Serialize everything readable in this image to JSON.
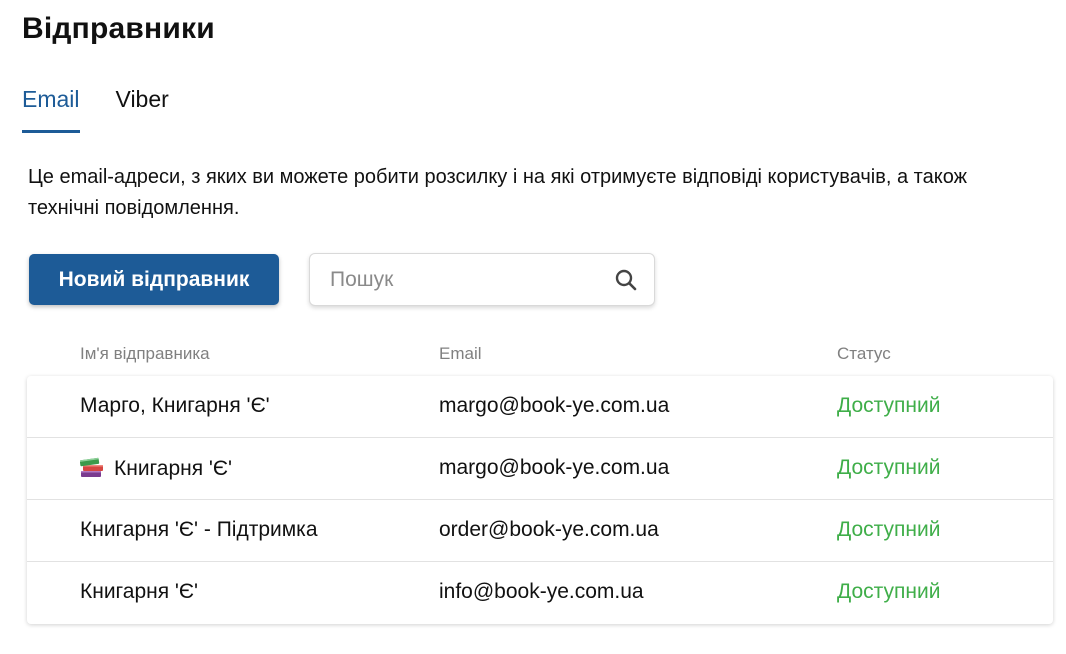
{
  "page": {
    "title": "Відправники"
  },
  "tabs": [
    {
      "label": "Email",
      "active": true
    },
    {
      "label": "Viber",
      "active": false
    }
  ],
  "description": "Це email-адреси, з яких ви можете робити розсилку і на які отримуєте відповіді користувачів, а також технічні повідомлення.",
  "toolbar": {
    "new_sender_label": "Новий відправник",
    "search_placeholder": "Пошук",
    "search_value": "",
    "search_icon": "search-icon"
  },
  "table": {
    "headers": {
      "name": "Ім'я відправника",
      "email": "Email",
      "status": "Статус"
    },
    "rows": [
      {
        "name": "Марго, Книгарня 'Є'",
        "email": "margo@book-ye.com.ua",
        "status": "Доступний",
        "icon": ""
      },
      {
        "name": "Книгарня 'Є'",
        "email": "margo@book-ye.com.ua",
        "status": "Доступний",
        "icon": "books-icon"
      },
      {
        "name": "Книгарня 'Є' - Підтримка",
        "email": "order@book-ye.com.ua",
        "status": "Доступний",
        "icon": ""
      },
      {
        "name": "Книгарня 'Є'",
        "email": "info@book-ye.com.ua",
        "status": "Доступний",
        "icon": ""
      }
    ]
  },
  "colors": {
    "accent": "#1d5b97",
    "status_available": "#3fae49",
    "header_text": "#808080"
  }
}
